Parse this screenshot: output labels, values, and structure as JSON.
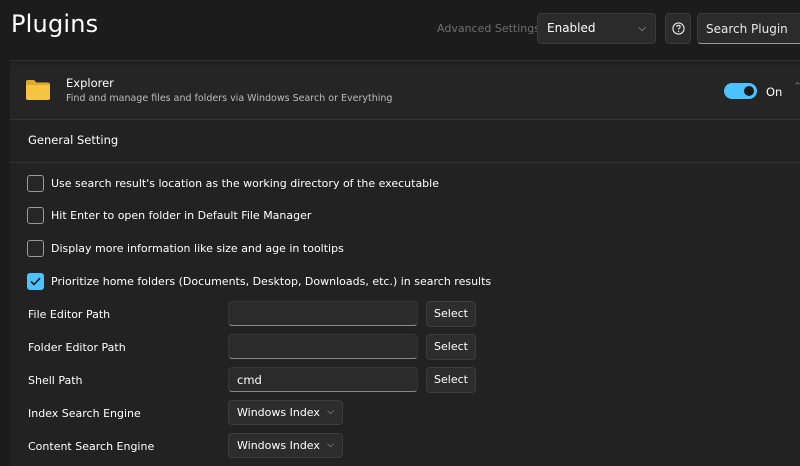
{
  "header": {
    "title": "Plugins",
    "advanced_settings_label": "Advanced Settings:",
    "advanced_settings_value": "Enabled",
    "search_placeholder": "Search Plugin"
  },
  "plugin": {
    "name": "Explorer",
    "description": "Find and manage files and folders via Windows Search or Everything",
    "toggle_label": "On",
    "enabled": true
  },
  "general": {
    "heading": "General Setting",
    "options": [
      {
        "label": "Use search result's location as the working directory of the executable",
        "checked": false
      },
      {
        "label": "Hit Enter to open folder in Default File Manager",
        "checked": false
      },
      {
        "label": "Display more information like size and age in tooltips",
        "checked": false
      },
      {
        "label": "Prioritize home folders (Documents, Desktop, Downloads, etc.) in search results",
        "checked": true
      }
    ],
    "paths": [
      {
        "label": "File Editor Path",
        "value": "",
        "button": "Select"
      },
      {
        "label": "Folder Editor Path",
        "value": "",
        "button": "Select"
      },
      {
        "label": "Shell Path",
        "value": "cmd",
        "button": "Select"
      }
    ],
    "engines": [
      {
        "label": "Index Search Engine",
        "value": "Windows Index"
      },
      {
        "label": "Content Search Engine",
        "value": "Windows Index"
      }
    ]
  },
  "colors": {
    "accent": "#4cc2ff",
    "background": "#1c1c1c",
    "folder": "#f5c542"
  }
}
